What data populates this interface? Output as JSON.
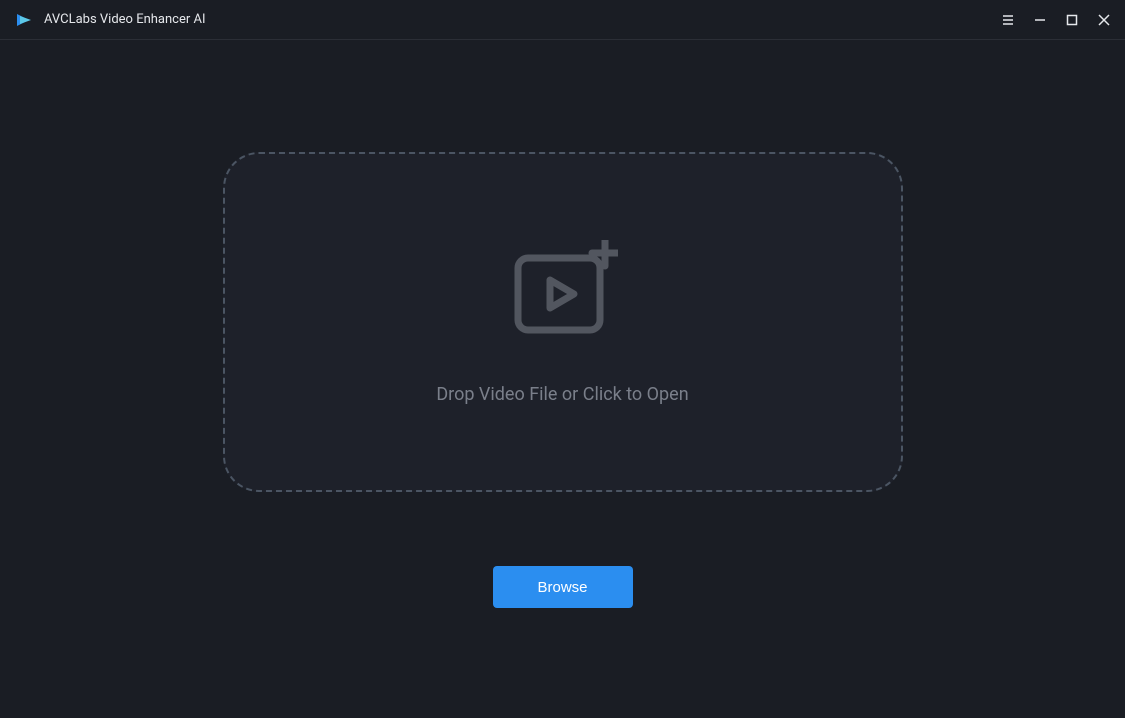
{
  "app": {
    "title": "AVCLabs Video Enhancer AI"
  },
  "main": {
    "drop_text": "Drop Video File or Click to Open",
    "browse_label": "Browse"
  }
}
